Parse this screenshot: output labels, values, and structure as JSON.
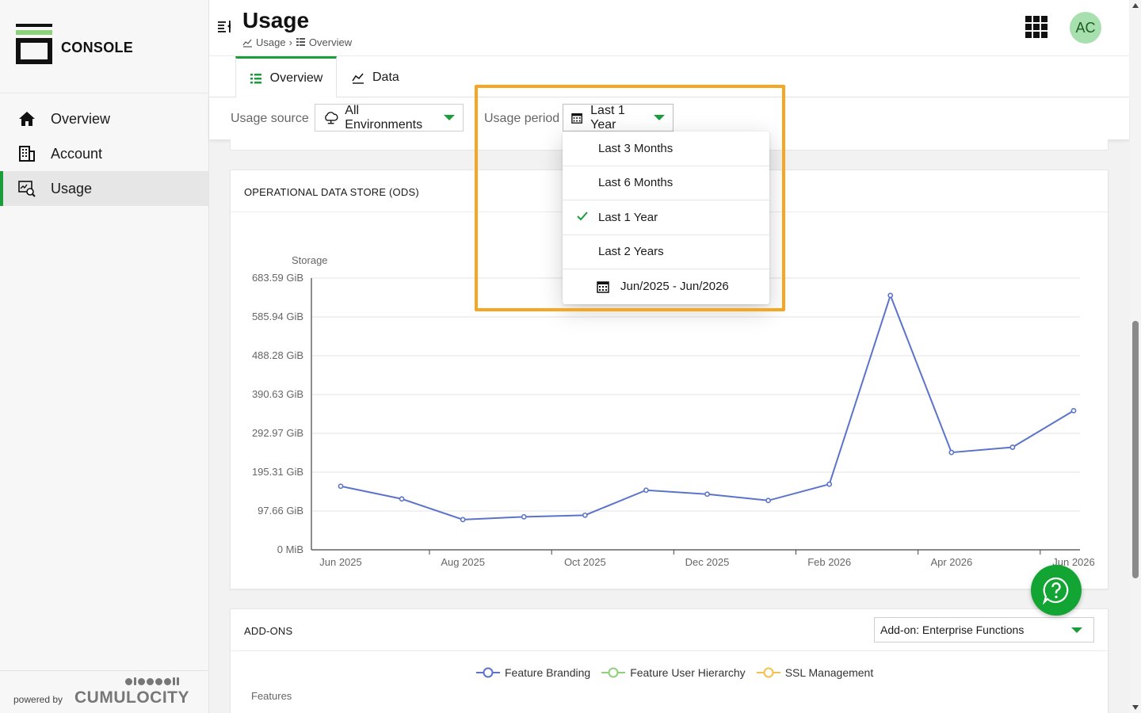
{
  "brand": {
    "name": "CONSOLE"
  },
  "sidebar": {
    "items": [
      {
        "label": "Overview",
        "icon": "home-icon"
      },
      {
        "label": "Account",
        "icon": "building-icon"
      },
      {
        "label": "Usage",
        "icon": "usage-monitor-icon",
        "active": true
      }
    ],
    "powered_by": "powered by",
    "powered_logo": "CUMULOCITY"
  },
  "header": {
    "title": "Usage",
    "breadcrumb": [
      "Usage",
      "Overview"
    ],
    "avatar_initials": "AC"
  },
  "tabs": [
    {
      "label": "Overview",
      "active": true
    },
    {
      "label": "Data",
      "active": false
    }
  ],
  "filters": {
    "source_label": "Usage source",
    "source_value": "All Environments",
    "period_label": "Usage period",
    "period_value": "Last 1 Year"
  },
  "period_dropdown": {
    "options": [
      "Last 3 Months",
      "Last 6 Months",
      "Last 1 Year",
      "Last 2 Years"
    ],
    "selected": "Last 1 Year",
    "custom_range": "Jun/2025 - Jun/2026"
  },
  "ods_card": {
    "title": "OPERATIONAL DATA STORE (ODS)"
  },
  "chart_data": {
    "type": "line",
    "title": "",
    "ylabel": "Storage",
    "xlabel": "",
    "y_tick_labels": [
      "0 MiB",
      "97.66 GiB",
      "195.31 GiB",
      "292.97 GiB",
      "390.63 GiB",
      "488.28 GiB",
      "585.94 GiB",
      "683.59 GiB"
    ],
    "y_ticks_gib": [
      0,
      97.66,
      195.31,
      292.97,
      390.63,
      488.28,
      585.94,
      683.59
    ],
    "ylim": [
      0,
      683.59
    ],
    "x_tick_labels": [
      "Jun 2025",
      "Aug 2025",
      "Oct 2025",
      "Dec 2025",
      "Feb 2026",
      "Apr 2026",
      "Jun 2026"
    ],
    "x": [
      "2025-06",
      "2025-07",
      "2025-08",
      "2025-09",
      "2025-10",
      "2025-11",
      "2025-12",
      "2026-01",
      "2026-02",
      "2026-03",
      "2026-04",
      "2026-05",
      "2026-06"
    ],
    "series": [
      {
        "values": [
          160,
          128,
          76,
          83,
          87,
          150,
          140,
          124,
          165,
          640,
          245,
          258,
          350
        ]
      }
    ],
    "grid": true,
    "color": "#5b74c9"
  },
  "addons_card": {
    "title": "ADD-ONS",
    "select_value": "Add-on: Enterprise Functions",
    "legend": [
      {
        "label": "Feature Branding",
        "color": "#5b74c9"
      },
      {
        "label": "Feature User Hierarchy",
        "color": "#8fd07a"
      },
      {
        "label": "SSL Management",
        "color": "#f4c14a"
      }
    ],
    "y_label": "Features"
  }
}
